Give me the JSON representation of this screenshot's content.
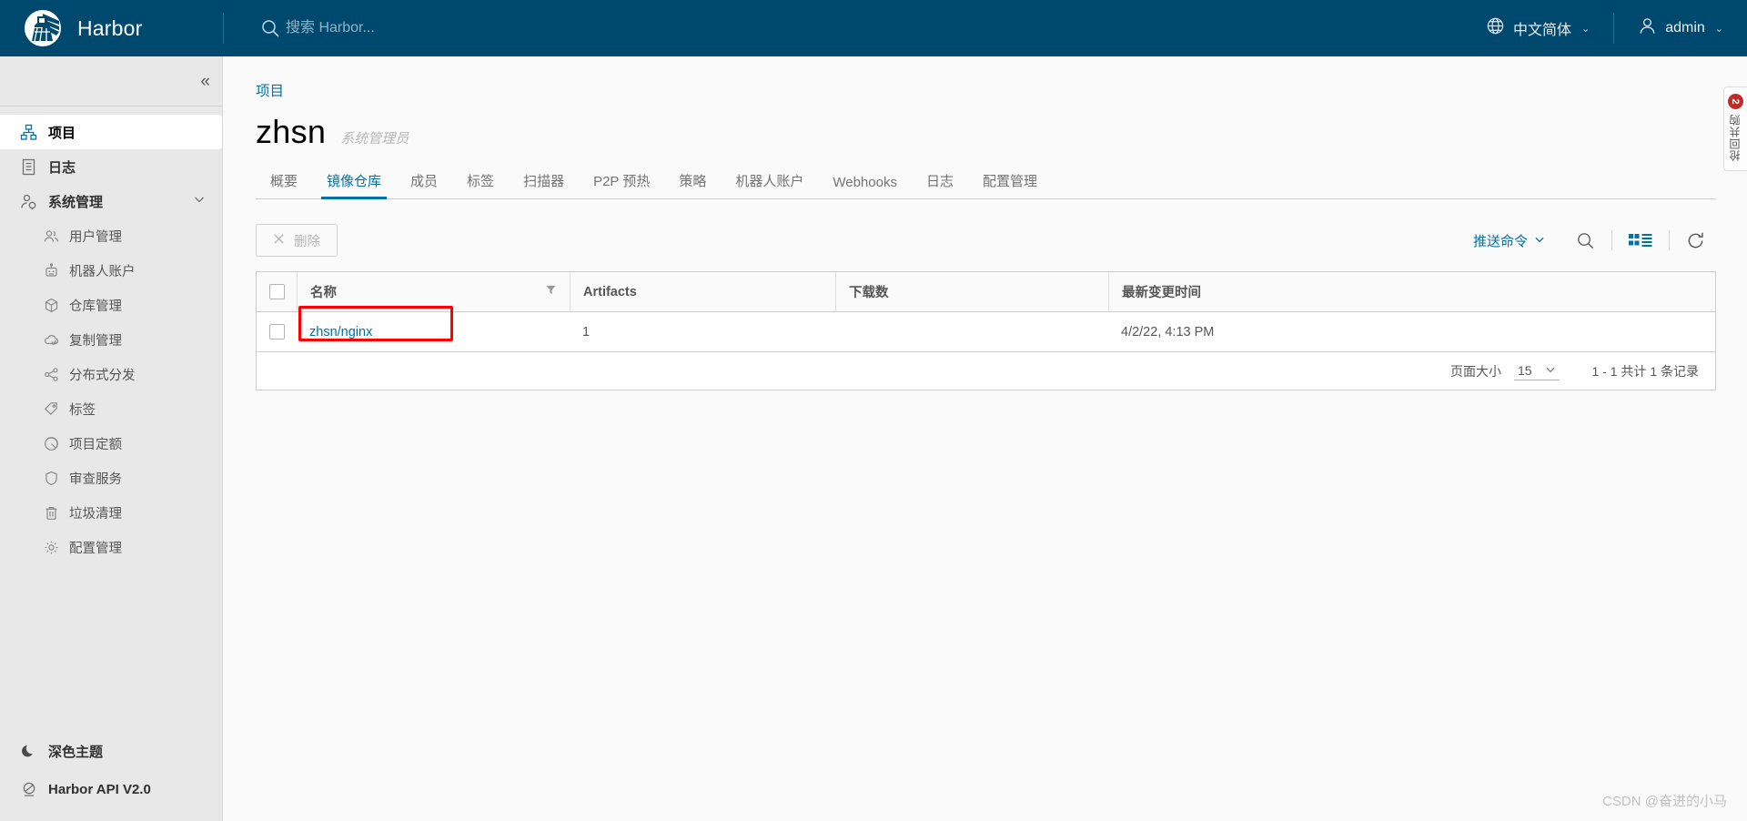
{
  "header": {
    "brand": "Harbor",
    "brand_logo_icon": "harbor-lighthouse-logo",
    "search_icon": "search-icon",
    "search_placeholder": "搜索 Harbor...",
    "search_value": "",
    "language": "中文简体",
    "language_icon": "globe-icon",
    "user": "admin",
    "user_icon": "user-icon",
    "caret": "⌄"
  },
  "sidebar": {
    "collapse_icon": "«",
    "items": [
      {
        "label": "项目",
        "icon": "projects-icon",
        "active": true
      },
      {
        "label": "日志",
        "icon": "list-icon",
        "active": false
      },
      {
        "label": "系统管理",
        "icon": "admin-user-icon",
        "active": false,
        "expandable": true,
        "expanded": true
      }
    ],
    "sub_items": [
      {
        "label": "用户管理",
        "icon": "users-icon"
      },
      {
        "label": "机器人账户",
        "icon": "robot-icon"
      },
      {
        "label": "仓库管理",
        "icon": "cube-icon"
      },
      {
        "label": "复制管理",
        "icon": "cloud-sync-icon"
      },
      {
        "label": "分布式分发",
        "icon": "share-icon"
      },
      {
        "label": "标签",
        "icon": "tag-icon"
      },
      {
        "label": "项目定额",
        "icon": "pie-chart-icon"
      },
      {
        "label": "审查服务",
        "icon": "shield-icon"
      },
      {
        "label": "垃圾清理",
        "icon": "trash-icon"
      },
      {
        "label": "配置管理",
        "icon": "gear-icon"
      }
    ],
    "bottom_items": [
      {
        "label": "深色主题",
        "icon": "moon-icon"
      },
      {
        "label": "Harbor API V2.0",
        "icon": "api-icon"
      }
    ]
  },
  "main": {
    "breadcrumb": "项目",
    "project_name": "zhsn",
    "project_role": "系统管理员",
    "tabs": [
      {
        "label": "概要",
        "active": false
      },
      {
        "label": "镜像仓库",
        "active": true
      },
      {
        "label": "成员",
        "active": false
      },
      {
        "label": "标签",
        "active": false
      },
      {
        "label": "扫描器",
        "active": false
      },
      {
        "label": "P2P 预热",
        "active": false
      },
      {
        "label": "策略",
        "active": false
      },
      {
        "label": "机器人账户",
        "active": false
      },
      {
        "label": "Webhooks",
        "active": false
      },
      {
        "label": "日志",
        "active": false
      },
      {
        "label": "配置管理",
        "active": false
      }
    ],
    "toolbar": {
      "delete_label": "删除",
      "delete_icon": "close-icon",
      "delete_disabled": true,
      "push_command_label": "推送命令",
      "push_command_icon": "chevron-down-icon",
      "search_icon": "search-icon",
      "view_toggle_icon": "card-list-view-icon",
      "refresh_icon": "refresh-icon"
    },
    "table": {
      "columns": [
        "名称",
        "Artifacts",
        "下载数",
        "最新变更时间"
      ],
      "filter_icon": "filter-icon",
      "rows": [
        {
          "name": "zhsn/nginx",
          "artifacts": "1",
          "downloads": "",
          "updated": "4/2/22, 4:13 PM",
          "highlighted": true
        }
      ]
    },
    "pagination": {
      "page_size_label": "页面大小",
      "page_size_value": "15",
      "page_size_caret": "⌄",
      "total_text": "1 - 1 共计 1 条记录"
    }
  },
  "side_tab": {
    "badge": "2",
    "text": "抢回共购"
  },
  "watermark": "CSDN @奋进的小马",
  "colors": {
    "header_bg": "#00496e",
    "accent": "#0072a3",
    "sidebar_bg": "#e8e8e8",
    "highlight_red": "#ff0000",
    "badge_red": "#c32b26"
  }
}
